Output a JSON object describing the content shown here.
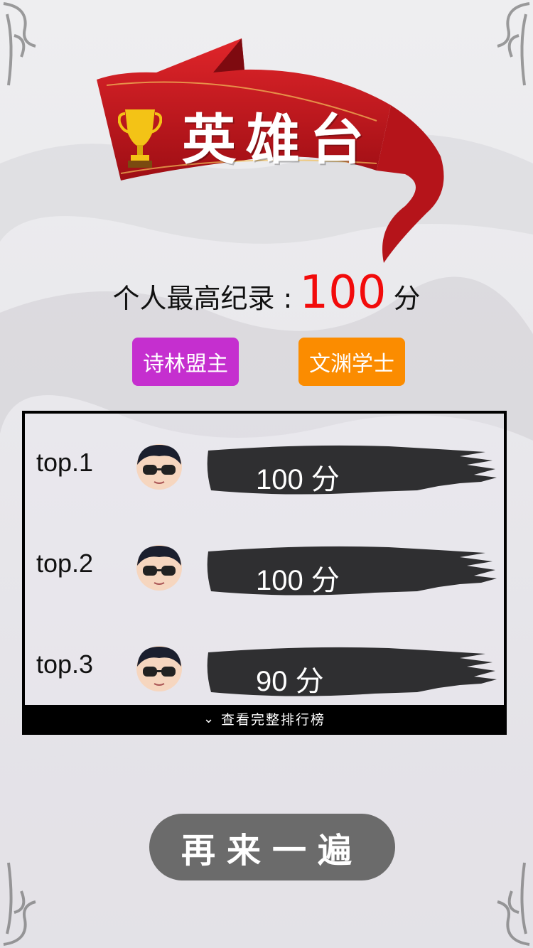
{
  "banner": {
    "title": "英雄台"
  },
  "record": {
    "label": "个人最高纪录 :",
    "value": "100",
    "unit": "分"
  },
  "tags": [
    {
      "label": "诗林盟主",
      "color": "#c52fcf"
    },
    {
      "label": "文渊学士",
      "color": "#fb8c00"
    }
  ],
  "leaderboard": {
    "rows": [
      {
        "rank": "top.1",
        "score": "100 分"
      },
      {
        "rank": "top.2",
        "score": "100 分"
      },
      {
        "rank": "top.3",
        "score": "90 分"
      }
    ],
    "footer_label": "查看完整排行榜"
  },
  "replay_label": "再来一遍",
  "icons": [
    "trophy-icon",
    "chevron-down-icon",
    "avatar-icon"
  ],
  "colors": {
    "accent_red": "#f20b0b",
    "ribbon": "#c8161d",
    "button": "#6b6b6b"
  }
}
